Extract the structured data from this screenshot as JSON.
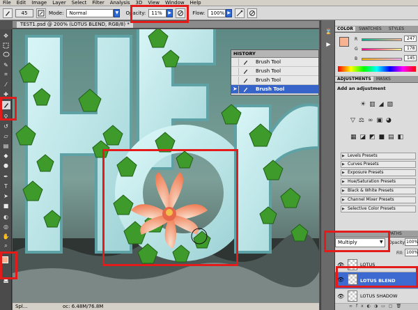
{
  "menu": {
    "items": [
      "File",
      "Edit",
      "Image",
      "Layer",
      "Select",
      "Filter",
      "Analysis",
      "3D",
      "View",
      "Window",
      "Help"
    ]
  },
  "options": {
    "mode_label": "Mode:",
    "mode_value": "Normal",
    "opacity_label": "Opacity:",
    "opacity_value": "11%",
    "flow_label": "Flow:",
    "flow_value": "100%",
    "brush_size": "45"
  },
  "document": {
    "tab_title": "TEST1.psd @ 200% (LOTUS BLEND, RGB/8) *",
    "status_zoom": "Spl...",
    "status_doc": "oc: 6.48M/76.8M"
  },
  "history": {
    "title": "HISTORY",
    "items": [
      {
        "label": "Brush Tool",
        "selected": false
      },
      {
        "label": "Brush Tool",
        "selected": false
      },
      {
        "label": "Brush Tool",
        "selected": false
      },
      {
        "label": "Brush Tool",
        "selected": true
      }
    ]
  },
  "color": {
    "tabs": [
      "COLOR",
      "SWATCHES",
      "STYLES"
    ],
    "r_label": "R",
    "g_label": "G",
    "b_label": "B",
    "r": "247",
    "g": "178",
    "b": "145",
    "swatch": "#f7b291"
  },
  "adjustments": {
    "tabs": [
      "ADJUSTMENTS",
      "MASKS"
    ],
    "heading": "Add an adjustment",
    "presets": [
      "Levels Presets",
      "Curves Presets",
      "Exposure Presets",
      "Hue/Saturation Presets",
      "Black & White Presets",
      "Channel Mixer Presets",
      "Selective Color Presets"
    ]
  },
  "layers": {
    "tab": "PATHS",
    "blend_mode": "Multiply",
    "opacity_label": "Opacity:",
    "opacity_value": "100%",
    "fill_label": "Fill:",
    "fill_value": "100%",
    "items": [
      {
        "name": "LOTUS",
        "selected": false
      },
      {
        "name": "LOTUS BLEND",
        "selected": true
      },
      {
        "name": "LOTUS SHADOW",
        "selected": false
      }
    ]
  },
  "accent": {
    "highlight": "#e31b1b",
    "selection": "#3764c8"
  }
}
